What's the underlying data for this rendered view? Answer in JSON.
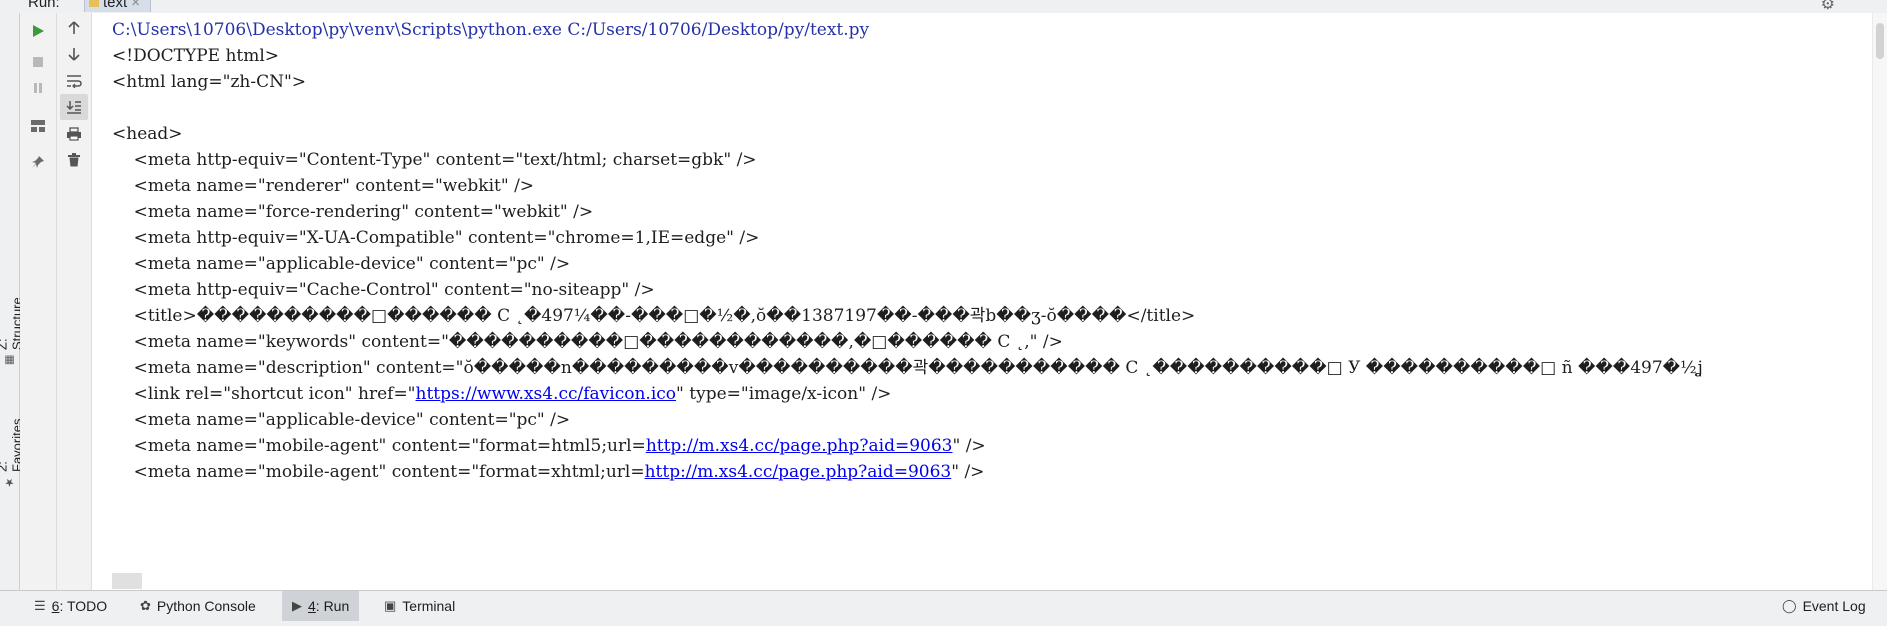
{
  "top": {
    "run_label": "Run:",
    "tab_label": "text",
    "tab_close": "×"
  },
  "left_strip": {
    "structure_label": "Z: Structure",
    "favorites_label": "2: Favorites"
  },
  "console": {
    "lines": [
      "C:\\Users\\10706\\Desktop\\py\\venv\\Scripts\\python.exe C:/Users/10706/Desktop/py/text.py",
      "<!DOCTYPE html>",
      "<html lang=\"zh-CN\">",
      "",
      "<head>",
      "    <meta http-equiv=\"Content-Type\" content=\"text/html; charset=gbk\" />",
      "    <meta name=\"renderer\" content=\"webkit\" />",
      "    <meta name=\"force-rendering\" content=\"webkit\" />",
      "    <meta http-equiv=\"X-UA-Compatible\" content=\"chrome=1,IE=edge\" />",
      "    <meta name=\"applicable-device\" content=\"pc\" />",
      "    <meta http-equiv=\"Cache-Control\" content=\"no-siteapp\" />",
      "    <title>����������□������ C ˛�497¼��-���□�½�,ŏ��1387197��-���곽b��ʒ-ŏ����</title>",
      "    <meta name=\"keywords\" content=\"����������□������������,�□������ C ˛,\" />",
      "    <meta name=\"description\" content=\"ŏ�����n���������v����������곽����������� C ˛����������□ У ����������□ ñ ���497�½ʝ",
      "    <link rel=\"shortcut icon\" href=\"",
      "    <meta name=\"applicable-device\" content=\"pc\" />",
      "    <meta name=\"mobile-agent\" content=\"format=html5;url=",
      "    <meta name=\"mobile-agent\" content=\"format=xhtml;url="
    ],
    "favicon_url": "https://www.xs4.cc/favicon.ico",
    "favicon_suffix": "\" type=\"image/x-icon\" />",
    "mobile_url": "http://m.xs4.cc/page.php?aid=9063",
    "mobile_suffix": "\" />"
  },
  "bottom": {
    "todo_mn": "6",
    "todo_rest": ": TODO",
    "python_console": "Python Console",
    "run_mn": "4",
    "run_rest": ": Run",
    "terminal": "Terminal",
    "event_log": "Event Log"
  },
  "icons": {
    "run": "play-icon",
    "stop": "stop-icon",
    "pause": "pause-icon",
    "layout": "layout-icon",
    "pin": "pin-icon",
    "up": "arrow-up-icon",
    "down": "arrow-down-icon",
    "wrap": "soft-wrap-icon",
    "scroll_end": "scroll-to-end-icon",
    "print": "print-icon",
    "trash": "trash-icon"
  },
  "colors": {
    "run_green": "#3b9a3b",
    "path_blue": "#2531a8",
    "link_blue": "#0000ee"
  }
}
